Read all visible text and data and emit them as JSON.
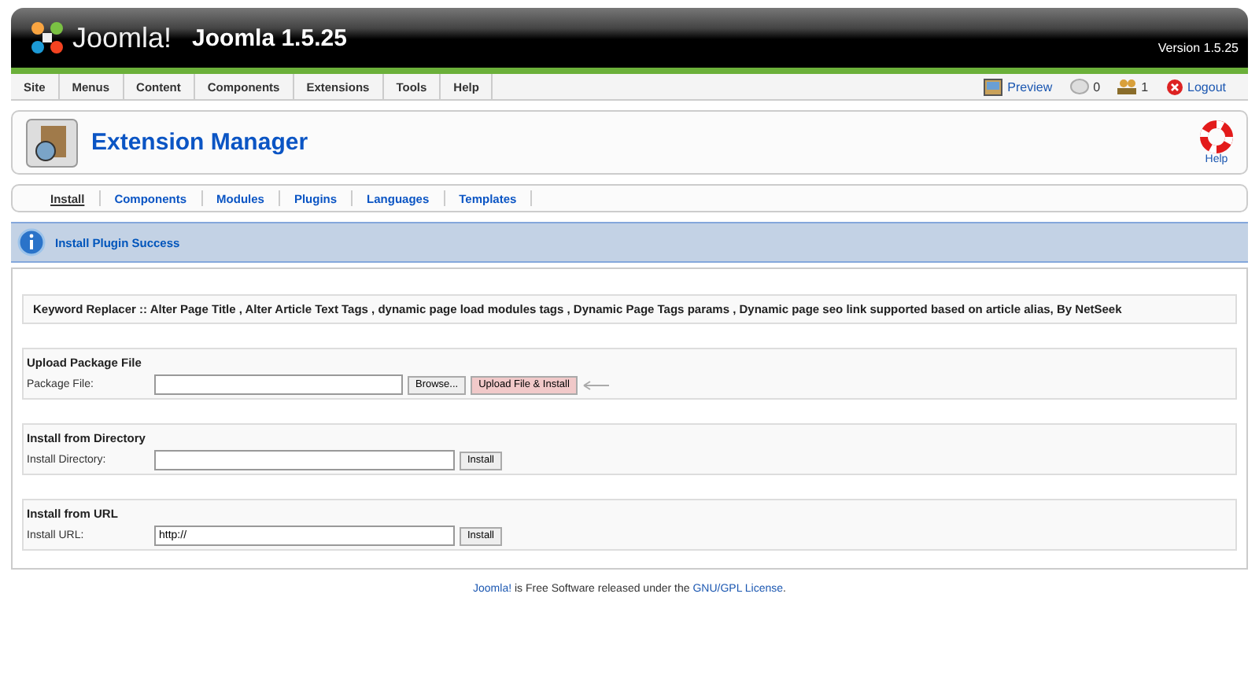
{
  "header": {
    "logo": "Joomla!",
    "title": "Joomla 1.5.25",
    "version": "Version 1.5.25"
  },
  "menu": [
    {
      "label": "Site"
    },
    {
      "label": "Menus"
    },
    {
      "label": "Content"
    },
    {
      "label": "Components"
    },
    {
      "label": "Extensions"
    },
    {
      "label": "Tools"
    },
    {
      "label": "Help"
    }
  ],
  "status": {
    "preview": "Preview",
    "messages": "0",
    "users": "1",
    "logout": "Logout"
  },
  "toolbar": {
    "title": "Extension Manager",
    "help": "Help"
  },
  "tabs": [
    {
      "label": "Install",
      "selected": true
    },
    {
      "label": "Components",
      "selected": false
    },
    {
      "label": "Modules",
      "selected": false
    },
    {
      "label": "Plugins",
      "selected": false
    },
    {
      "label": "Languages",
      "selected": false
    },
    {
      "label": "Templates",
      "selected": false
    }
  ],
  "message": "Install Plugin Success",
  "description": "Keyword Replacer :: Alter Page Title , Alter Article Text Tags , dynamic page load modules tags , Dynamic Page Tags params , Dynamic page seo link supported based on article alias, By NetSeek",
  "sections": [
    {
      "kind": "file",
      "title": "Upload Package File",
      "label": "Package File:",
      "browse": "Browse...",
      "button": "Upload File & Install"
    },
    {
      "kind": "text",
      "title": "Install from Directory",
      "label": "Install Directory:",
      "button": "Install"
    },
    {
      "kind": "text",
      "title": "Install from URL",
      "label": "Install URL:",
      "value": "http://",
      "button": "Install"
    }
  ],
  "footer": {
    "link": "Joomla!",
    "text": " is Free Software released under the ",
    "license": "GNU/GPL License",
    "end": "."
  }
}
